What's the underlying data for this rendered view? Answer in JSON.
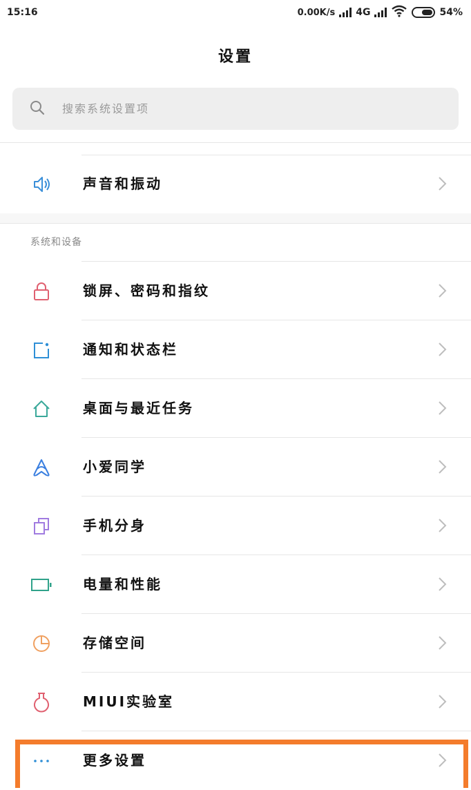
{
  "status_bar": {
    "time": "15:16",
    "net_speed": "0.00K/s",
    "network_type": "4G",
    "battery": "54%"
  },
  "header": {
    "title": "设置"
  },
  "search": {
    "placeholder": "搜索系统设置项"
  },
  "top_items": [
    {
      "label": "声音和振动",
      "icon": "speaker-icon",
      "color": "#3a8fd9"
    }
  ],
  "section": {
    "title": "系统和设备",
    "items": [
      {
        "label": "锁屏、密码和指纹",
        "icon": "lock-icon",
        "color": "#e06070"
      },
      {
        "label": "通知和状态栏",
        "icon": "notification-icon",
        "color": "#2e8fd6"
      },
      {
        "label": "桌面与最近任务",
        "icon": "home-icon",
        "color": "#3aa89a"
      },
      {
        "label": "小爱同学",
        "icon": "xiaoai-icon",
        "color": "#3a7fe0"
      },
      {
        "label": "手机分身",
        "icon": "clone-icon",
        "color": "#a07be0"
      },
      {
        "label": "电量和性能",
        "icon": "battery-icon",
        "color": "#2fa28a"
      },
      {
        "label": "存储空间",
        "icon": "storage-icon",
        "color": "#f0a060"
      },
      {
        "label": "MIUI实验室",
        "icon": "flask-icon",
        "color": "#e06070"
      },
      {
        "label": "更多设置",
        "icon": "more-icon",
        "color": "#2e8fd6"
      }
    ]
  },
  "highlight_color": "#f47c2c"
}
